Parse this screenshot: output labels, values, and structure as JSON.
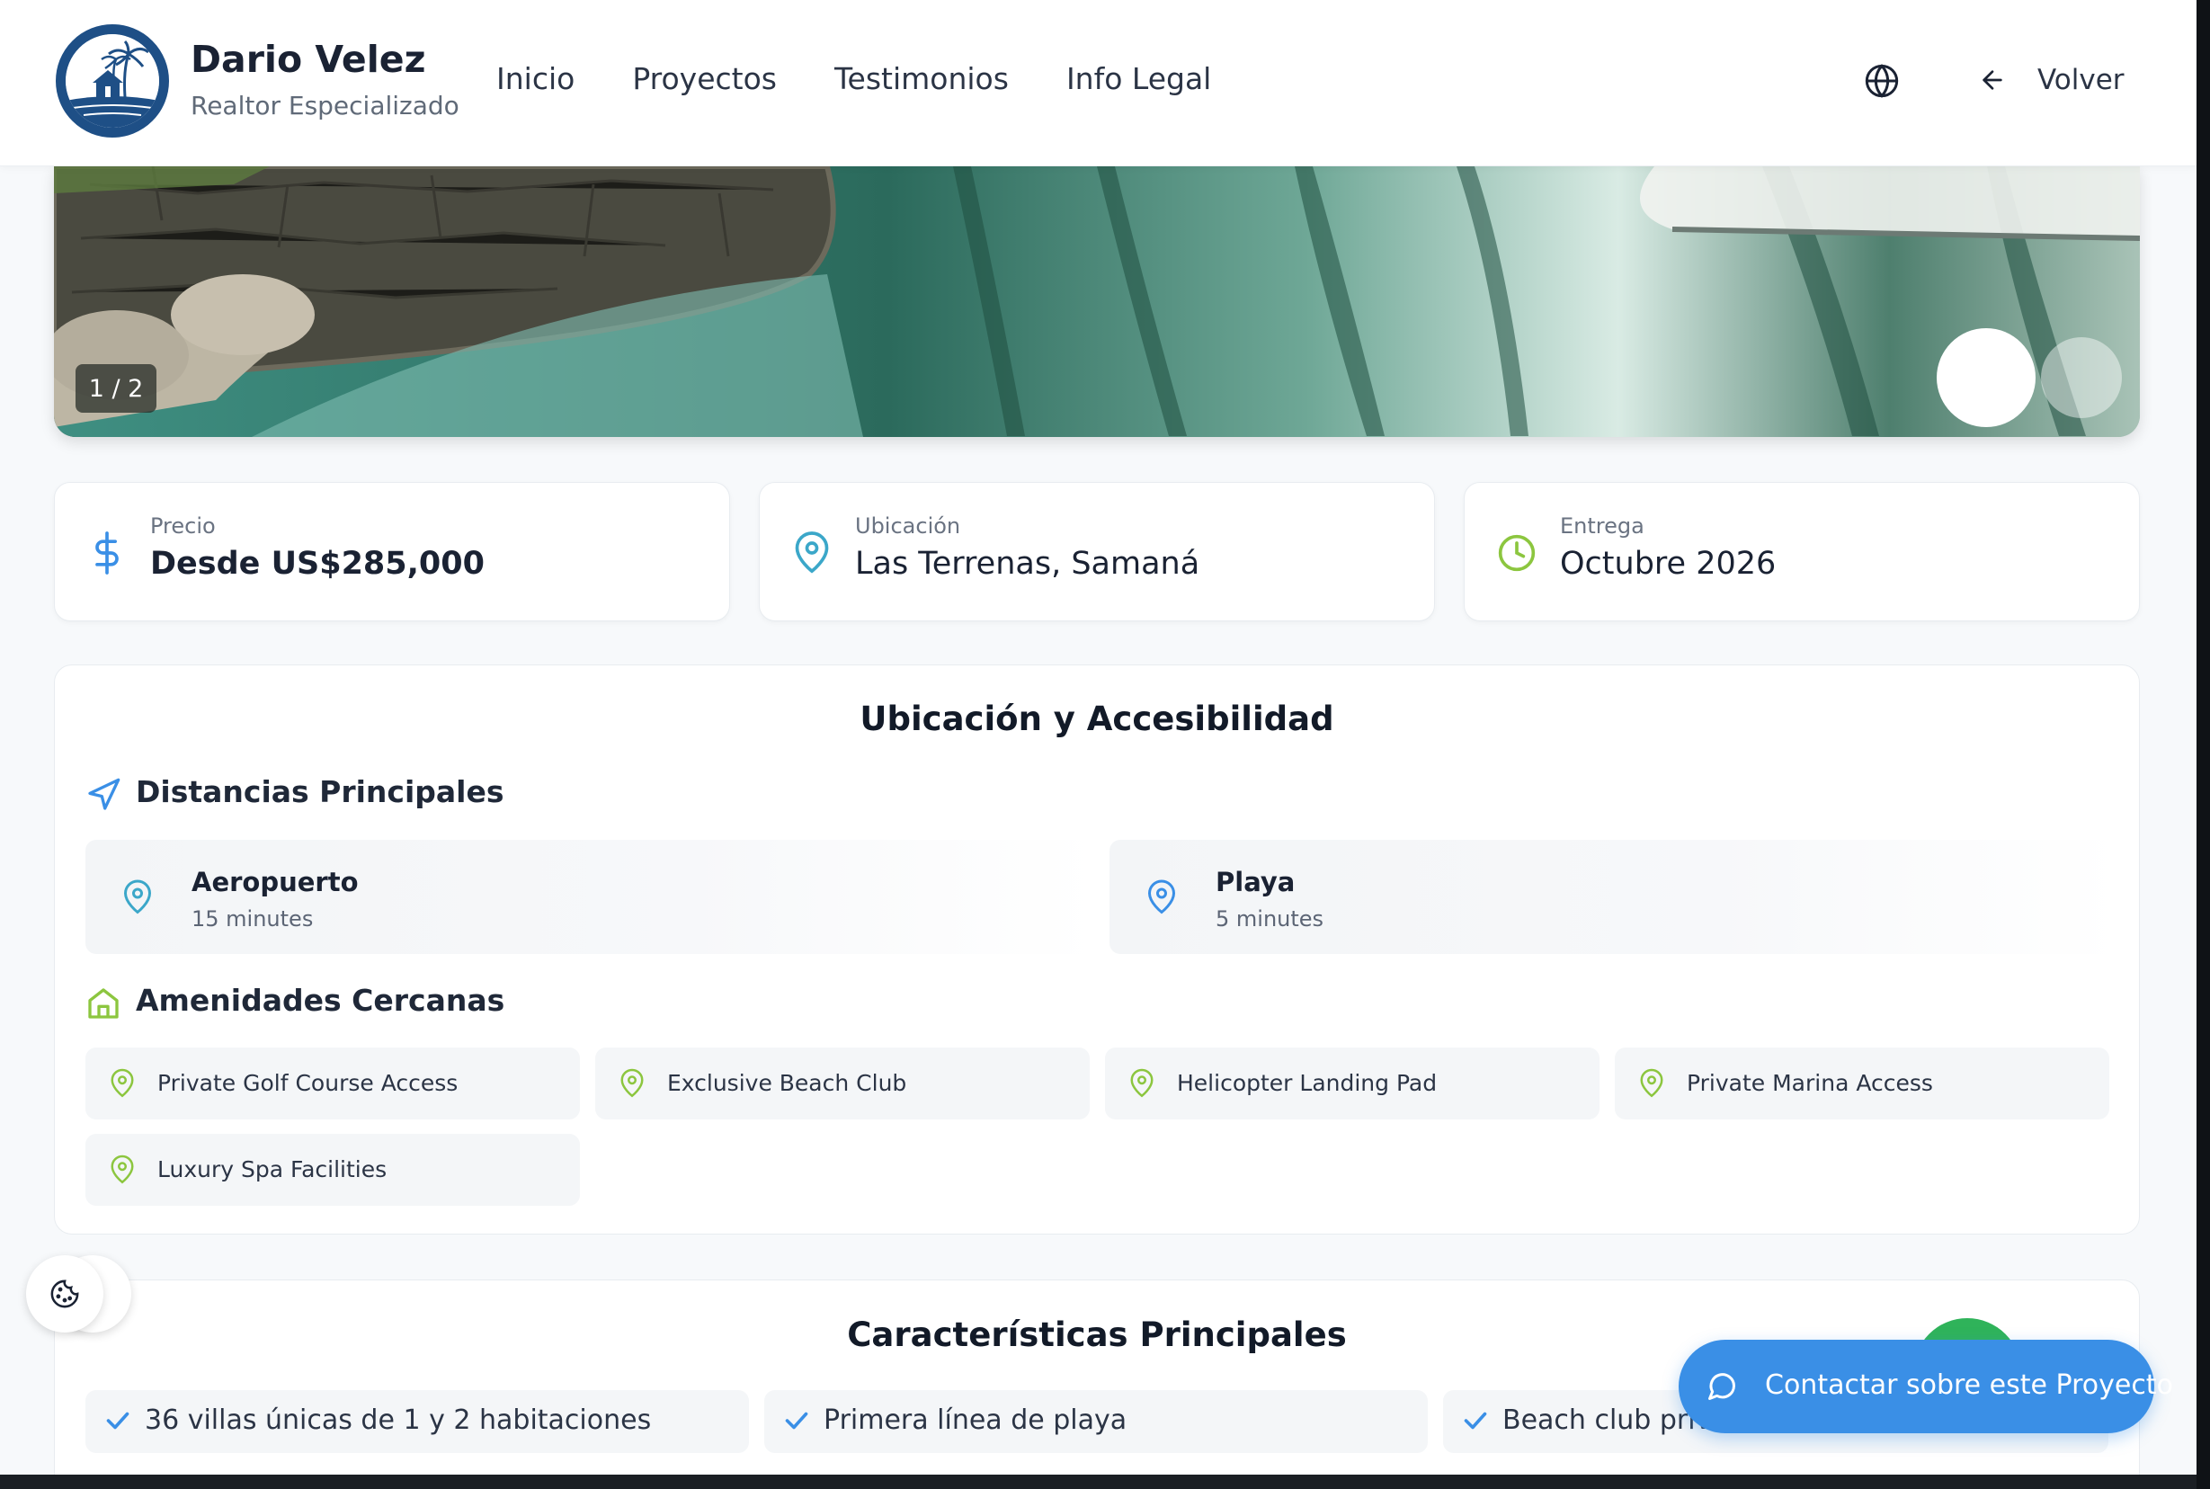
{
  "header": {
    "brand_name": "Dario Velez",
    "brand_subtitle": "Realtor Especializado",
    "nav": [
      "Inicio",
      "Proyectos",
      "Testimonios",
      "Info Legal"
    ],
    "back_label": "Volver"
  },
  "hero": {
    "counter": "1 / 2"
  },
  "info": {
    "price_label": "Precio",
    "price_value": "Desde US$285,000",
    "location_label": "Ubicación",
    "location_value": "Las Terrenas, Samaná",
    "delivery_label": "Entrega",
    "delivery_value": "Octubre 2026"
  },
  "location_section": {
    "title": "Ubicación y Accesibilidad",
    "distances_title": "Distancias Principales",
    "distances": [
      {
        "name": "Aeropuerto",
        "time": "15 minutes"
      },
      {
        "name": "Playa",
        "time": "5 minutes"
      }
    ],
    "amenities_title": "Amenidades Cercanas",
    "amenities": [
      "Private Golf Course Access",
      "Exclusive Beach Club",
      "Helicopter Landing Pad",
      "Private Marina Access",
      "Luxury Spa Facilities"
    ]
  },
  "features_section": {
    "title": "Características Principales",
    "features": [
      "36 villas únicas de 1 y 2 habitaciones",
      "Primera línea de playa",
      "Beach club priva"
    ]
  },
  "contact": {
    "label": "Contactar sobre este Proyecto"
  },
  "colors": {
    "accent_blue": "#3a8fe6",
    "teal_icon": "#3ba7c9",
    "green_icon": "#8cc63f",
    "brand_navy": "#1e4f86"
  }
}
